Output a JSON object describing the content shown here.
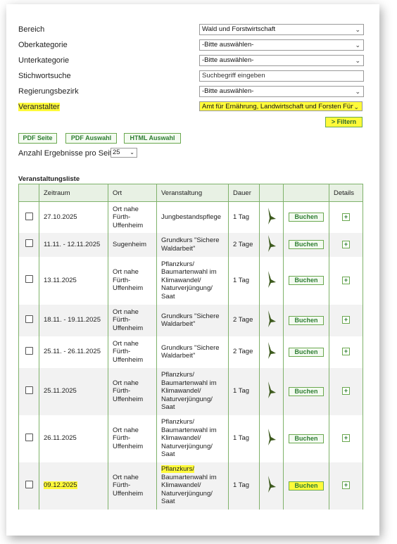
{
  "filters": {
    "bereich": {
      "label": "Bereich",
      "value": "Wald und Forstwirtschaft"
    },
    "oberkategorie": {
      "label": "Oberkategorie",
      "value": "-Bitte auswählen-"
    },
    "unterkategorie": {
      "label": "Unterkategorie",
      "value": "-Bitte auswählen-"
    },
    "stichwortsuche": {
      "label": "Stichwortsuche",
      "value": "Suchbegriff eingeben"
    },
    "regierungsbezirk": {
      "label": "Regierungsbezirk",
      "value": "-Bitte auswählen-"
    },
    "veranstalter": {
      "label": "Veranstalter",
      "value": "Amt für Ernährung, Landwirtschaft und Forsten Fürth"
    },
    "filter_button": "> Filtern"
  },
  "export_buttons": {
    "pdf_seite": "PDF Seite",
    "pdf_auswahl": "PDF Auswahl",
    "html_auswahl": "HTML Auswahl"
  },
  "per_page": {
    "label": "Anzahl Ergebnisse pro Seite:",
    "value": "25"
  },
  "list": {
    "title": "Veranstaltungsliste",
    "headers": {
      "zeitraum": "Zeitraum",
      "ort": "Ort",
      "veranstaltung": "Veranstaltung",
      "dauer": "Dauer",
      "details": "Details"
    },
    "book_label": "Buchen",
    "icons": {
      "checkbox": "checkbox",
      "logo": "forst-logo-icon",
      "details": "plus-icon"
    },
    "rows": [
      {
        "zeitraum": "27.10.2025",
        "ort": "Ort nahe Fürth-Uffenheim",
        "veranstaltung": "Jungbestandspflege",
        "dauer": "1 Tag"
      },
      {
        "zeitraum": "11.11. - 12.11.2025",
        "ort": "Sugenheim",
        "veranstaltung": "Grundkurs \"Sichere Waldarbeit\"",
        "dauer": "2 Tage"
      },
      {
        "zeitraum": "13.11.2025",
        "ort": "Ort nahe Fürth-Uffenheim",
        "veranstaltung": "Pflanzkurs/ Baumartenwahl im Klimawandel/ Naturverjüngung/ Saat",
        "dauer": "1 Tag"
      },
      {
        "zeitraum": "18.11. - 19.11.2025",
        "ort": "Ort nahe Fürth-Uffenheim",
        "veranstaltung": "Grundkurs \"Sichere Waldarbeit\"",
        "dauer": "2 Tage"
      },
      {
        "zeitraum": "25.11. - 26.11.2025",
        "ort": "Ort nahe Fürth-Uffenheim",
        "veranstaltung": "Grundkurs \"Sichere Waldarbeit\"",
        "dauer": "2 Tage"
      },
      {
        "zeitraum": "25.11.2025",
        "ort": "Ort nahe Fürth-Uffenheim",
        "veranstaltung": "Pflanzkurs/ Baumartenwahl im Klimawandel/ Naturverjüngung/ Saat",
        "dauer": "1 Tag"
      },
      {
        "zeitraum": "26.11.2025",
        "ort": "Ort nahe Fürth-Uffenheim",
        "veranstaltung": "Pflanzkurs/ Baumartenwahl im Klimawandel/ Naturverjüngung/ Saat",
        "dauer": "1 Tag"
      },
      {
        "zeitraum": "09.12.2025",
        "ort": "Ort nahe Fürth-Uffenheim",
        "veranstaltung_highlight": "Pflanzkurs/",
        "veranstaltung": "Baumartenwahl im Klimawandel/ Naturverjüngung/ Saat",
        "dauer": "1 Tag"
      }
    ]
  },
  "colors": {
    "highlight": "#fffa3a",
    "green_border": "#7fb26a",
    "green_text": "#2e7d32",
    "logo_green": "#3d5a1e"
  }
}
